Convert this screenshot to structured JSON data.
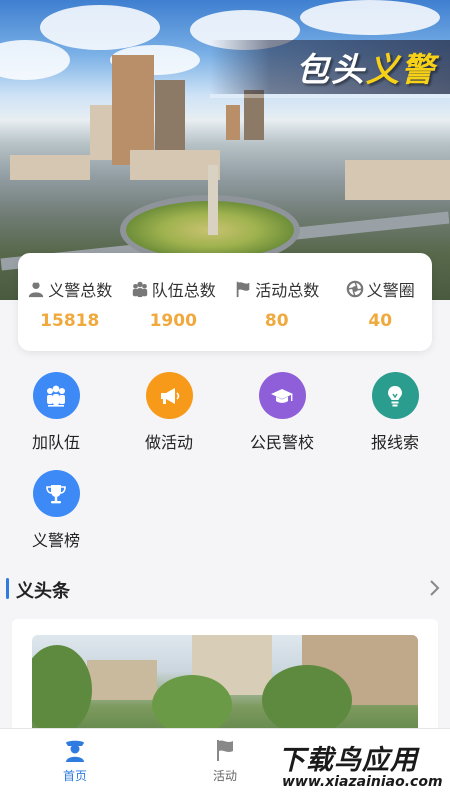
{
  "hero": {
    "title_main": "包头",
    "title_accent": "义警"
  },
  "stats": [
    {
      "icon": "person-badge-icon",
      "label": "义警总数",
      "value": "15818"
    },
    {
      "icon": "team-icon",
      "label": "队伍总数",
      "value": "1900"
    },
    {
      "icon": "flag-icon",
      "label": "活动总数",
      "value": "80"
    },
    {
      "icon": "shutter-icon",
      "label": "义警圈",
      "value": "40"
    }
  ],
  "features": [
    {
      "icon": "group-icon",
      "label": "加队伍",
      "color": "#3d8af7"
    },
    {
      "icon": "megaphone-icon",
      "label": "做活动",
      "color": "#f79a1a"
    },
    {
      "icon": "graduation-cap-icon",
      "label": "公民警校",
      "color": "#8e5fd8"
    },
    {
      "icon": "lightbulb-icon",
      "label": "报线索",
      "color": "#2a9d8f"
    },
    {
      "icon": "trophy-icon",
      "label": "义警榜",
      "color": "#3d8af7"
    }
  ],
  "section": {
    "title": "义头条"
  },
  "nav": [
    {
      "icon": "police-officer-icon",
      "label": "首页",
      "active": true
    },
    {
      "icon": "flag-icon",
      "label": "活动",
      "active": false
    }
  ],
  "watermark": {
    "main": "下载鸟应用",
    "sub": "www.xiazainiao.com"
  },
  "colors": {
    "accent": "#2f7be0",
    "stat_value": "#f0a93c",
    "hero_accent": "#f7d118"
  }
}
